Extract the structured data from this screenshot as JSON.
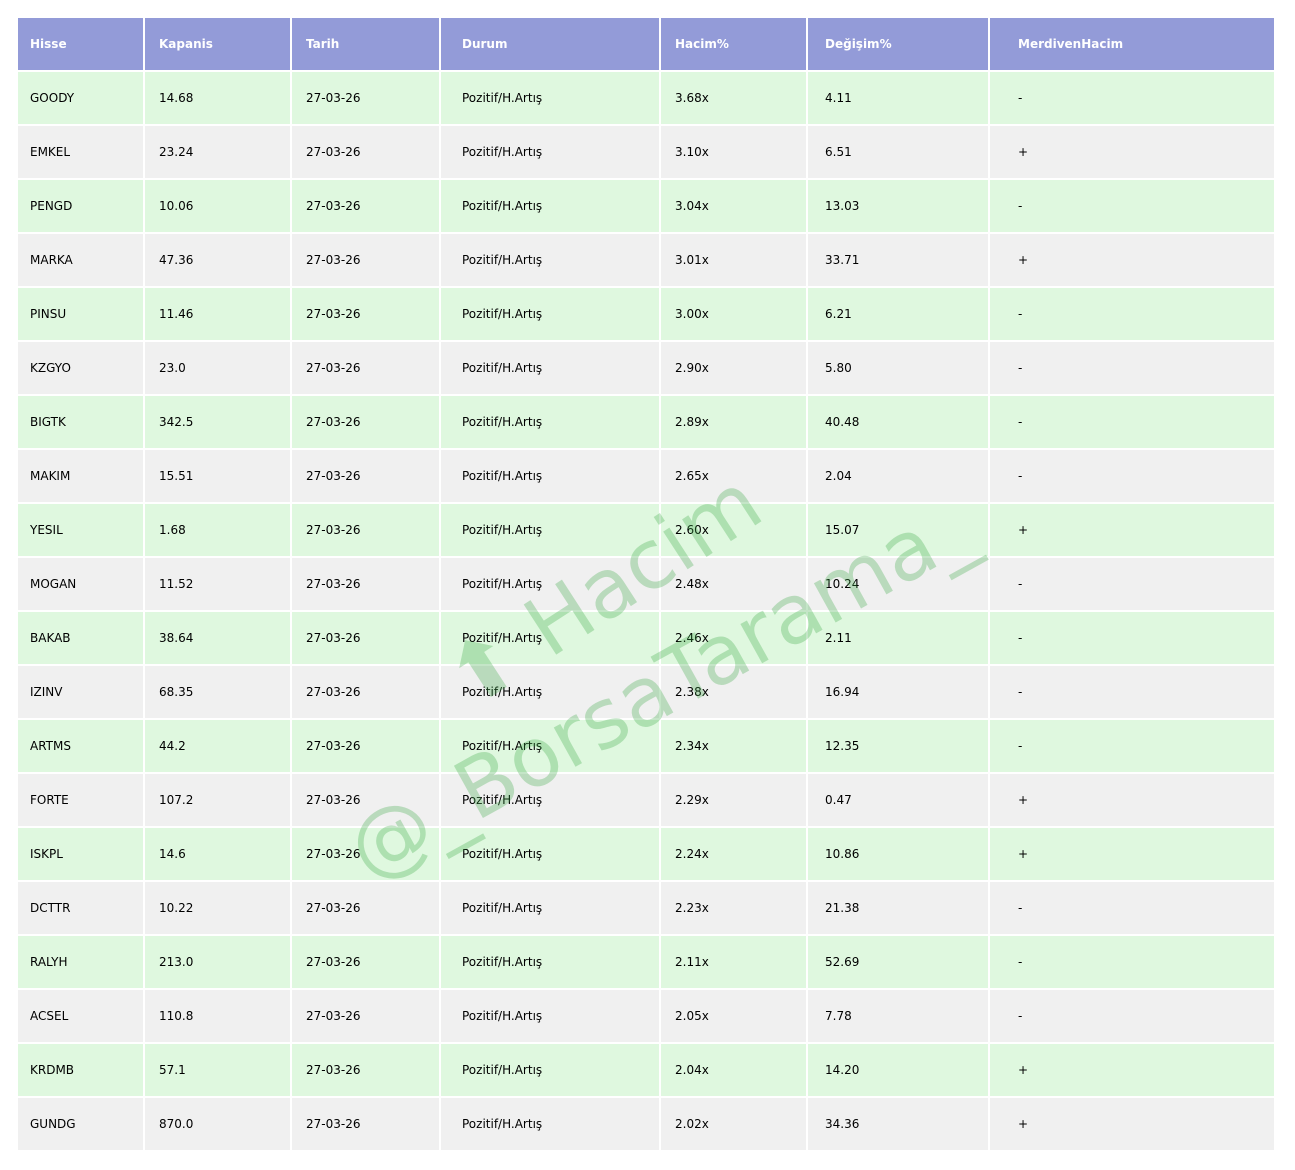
{
  "columns": [
    "Hisse",
    "Kapanis",
    "Tarih",
    "Durum",
    "Hacim%",
    "Değişim%",
    "MerdivenHacim"
  ],
  "rows": [
    [
      "GOODY",
      "14.68",
      "27-03-26",
      "Pozitif/H.Artış",
      "3.68x",
      "4.11",
      "-"
    ],
    [
      "EMKEL",
      "23.24",
      "27-03-26",
      "Pozitif/H.Artış",
      "3.10x",
      "6.51",
      "+"
    ],
    [
      "PENGD",
      "10.06",
      "27-03-26",
      "Pozitif/H.Artış",
      "3.04x",
      "13.03",
      "-"
    ],
    [
      "MARKA",
      "47.36",
      "27-03-26",
      "Pozitif/H.Artış",
      "3.01x",
      "33.71",
      "+"
    ],
    [
      "PINSU",
      "11.46",
      "27-03-26",
      "Pozitif/H.Artış",
      "3.00x",
      "6.21",
      "-"
    ],
    [
      "KZGYO",
      "23.0",
      "27-03-26",
      "Pozitif/H.Artış",
      "2.90x",
      "5.80",
      "-"
    ],
    [
      "BIGTK",
      "342.5",
      "27-03-26",
      "Pozitif/H.Artış",
      "2.89x",
      "40.48",
      "-"
    ],
    [
      "MAKIM",
      "15.51",
      "27-03-26",
      "Pozitif/H.Artış",
      "2.65x",
      "2.04",
      "-"
    ],
    [
      "YESIL",
      "1.68",
      "27-03-26",
      "Pozitif/H.Artış",
      "2.60x",
      "15.07",
      "+"
    ],
    [
      "MOGAN",
      "11.52",
      "27-03-26",
      "Pozitif/H.Artış",
      "2.48x",
      "10.24",
      "-"
    ],
    [
      "BAKAB",
      "38.64",
      "27-03-26",
      "Pozitif/H.Artış",
      "2.46x",
      "2.11",
      "-"
    ],
    [
      "IZINV",
      "68.35",
      "27-03-26",
      "Pozitif/H.Artış",
      "2.38x",
      "16.94",
      "-"
    ],
    [
      "ARTMS",
      "44.2",
      "27-03-26",
      "Pozitif/H.Artış",
      "2.34x",
      "12.35",
      "-"
    ],
    [
      "FORTE",
      "107.2",
      "27-03-26",
      "Pozitif/H.Artış",
      "2.29x",
      "0.47",
      "+"
    ],
    [
      "ISKPL",
      "14.6",
      "27-03-26",
      "Pozitif/H.Artış",
      "2.24x",
      "10.86",
      "+"
    ],
    [
      "DCTTR",
      "10.22",
      "27-03-26",
      "Pozitif/H.Artış",
      "2.23x",
      "21.38",
      "-"
    ],
    [
      "RALYH",
      "213.0",
      "27-03-26",
      "Pozitif/H.Artış",
      "2.11x",
      "52.69",
      "-"
    ],
    [
      "ACSEL",
      "110.8",
      "27-03-26",
      "Pozitif/H.Artış",
      "2.05x",
      "7.78",
      "-"
    ],
    [
      "KRDMB",
      "57.1",
      "27-03-26",
      "Pozitif/H.Artış",
      "2.04x",
      "14.20",
      "+"
    ],
    [
      "GUNDG",
      "870.0",
      "27-03-26",
      "Pozitif/H.Artış",
      "2.02x",
      "34.36",
      "+"
    ]
  ],
  "watermark": {
    "line1": "⬆ Hacim",
    "line2": "@_BorsaTarama_"
  },
  "colors": {
    "header": "#939bd8",
    "row_green": "#dff8df",
    "row_gray": "#f0f0f0"
  }
}
